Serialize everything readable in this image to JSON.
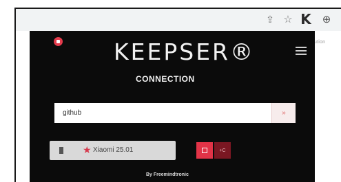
{
  "browser": {
    "toolbar_icons": [
      "share-icon",
      "star-icon",
      "keepser-extension-icon",
      "extensions-icon"
    ],
    "k_label": "K",
    "page_snippet": "ution"
  },
  "popup": {
    "logo": "KEEPSER®",
    "subtitle": "CONNECTION",
    "search": {
      "value": "github",
      "button_glyph": "»"
    },
    "entry": {
      "name": "Xiaomi 25.01"
    },
    "actions": {
      "secondary_glyph": "+C"
    },
    "footer": "By Freemindtronic",
    "colors": {
      "accent": "#e23347",
      "background": "#0b0b0b",
      "entry_bg": "#d9d9d9"
    }
  }
}
